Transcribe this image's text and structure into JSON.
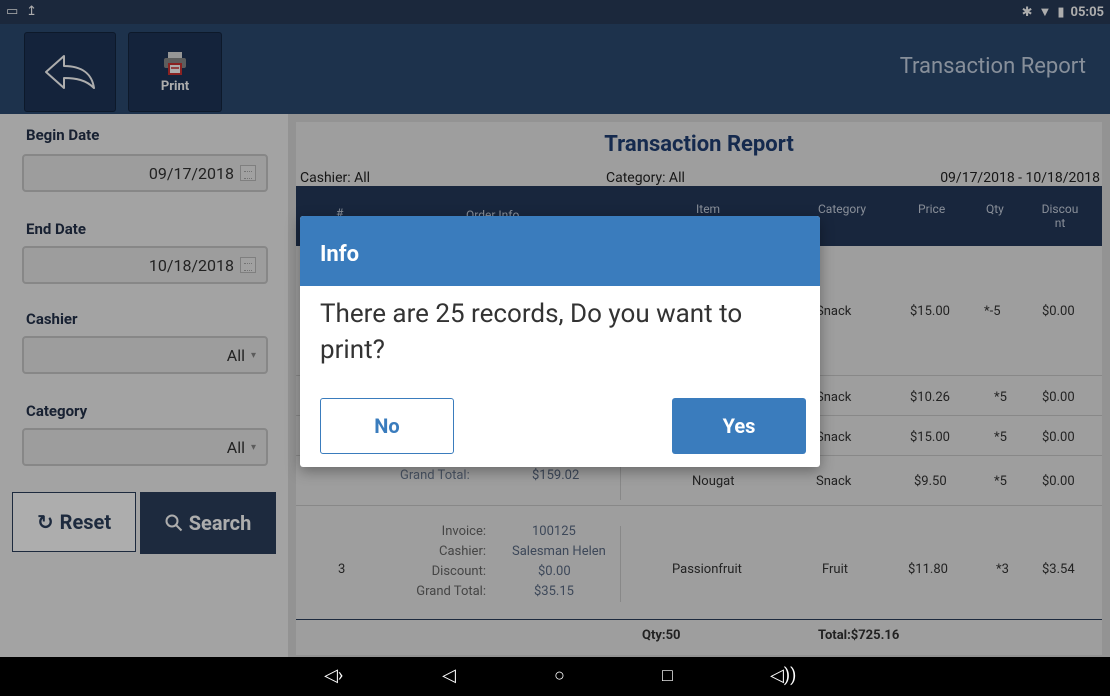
{
  "statusbar": {
    "time": "05:05"
  },
  "toolbar": {
    "print_label": "Print",
    "title": "Transaction Report"
  },
  "sidebar": {
    "begin_label": "Begin Date",
    "begin_value": "09/17/2018",
    "end_label": "End Date",
    "end_value": "10/18/2018",
    "cashier_label": "Cashier",
    "cashier_value": "All",
    "category_label": "Category",
    "category_value": "All",
    "reset_label": "Reset",
    "search_label": "Search"
  },
  "report": {
    "title": "Transaction Report",
    "cashier": "Cashier: All",
    "category": "Category: All",
    "range": "09/17/2018 - 10/18/2018",
    "headers": {
      "num": "#",
      "order": "Order Info",
      "item": "Item",
      "category": "Category",
      "price": "Price",
      "qty": "Qty",
      "discount": "Discou\nnt"
    },
    "rows": [
      {
        "category": "Snack",
        "price": "$15.00",
        "qty": "*-5",
        "discount": "$0.00"
      },
      {
        "category": "Snack",
        "price": "$10.26",
        "qty": "*5",
        "discount": "$0.00"
      },
      {
        "category": "Snack",
        "price": "$15.00",
        "qty": "*5",
        "discount": "$0.00"
      },
      {
        "label": "Grand Total:",
        "value": "$159.02",
        "item": "Nougat",
        "category": "Snack",
        "price": "$9.50",
        "qty": "*5",
        "discount": "$0.00"
      }
    ],
    "order3": {
      "num": "3",
      "invoice_label": "Invoice:",
      "invoice": "100125",
      "cashier_label": "Cashier:",
      "cashier": "Salesman Helen",
      "discount_label": "Discount:",
      "discount": "$0.00",
      "total_label": "Grand Total:",
      "total": "$35.15",
      "item": "Passionfruit",
      "category": "Fruit",
      "price": "$11.80",
      "qty": "*3",
      "discount_col": "$3.54"
    },
    "totals": {
      "qty": "Qty:50",
      "total": "Total:$725.16"
    }
  },
  "dialog": {
    "title": "Info",
    "message": "There are 25 records, Do you want to print?",
    "no_label": "No",
    "yes_label": "Yes"
  }
}
